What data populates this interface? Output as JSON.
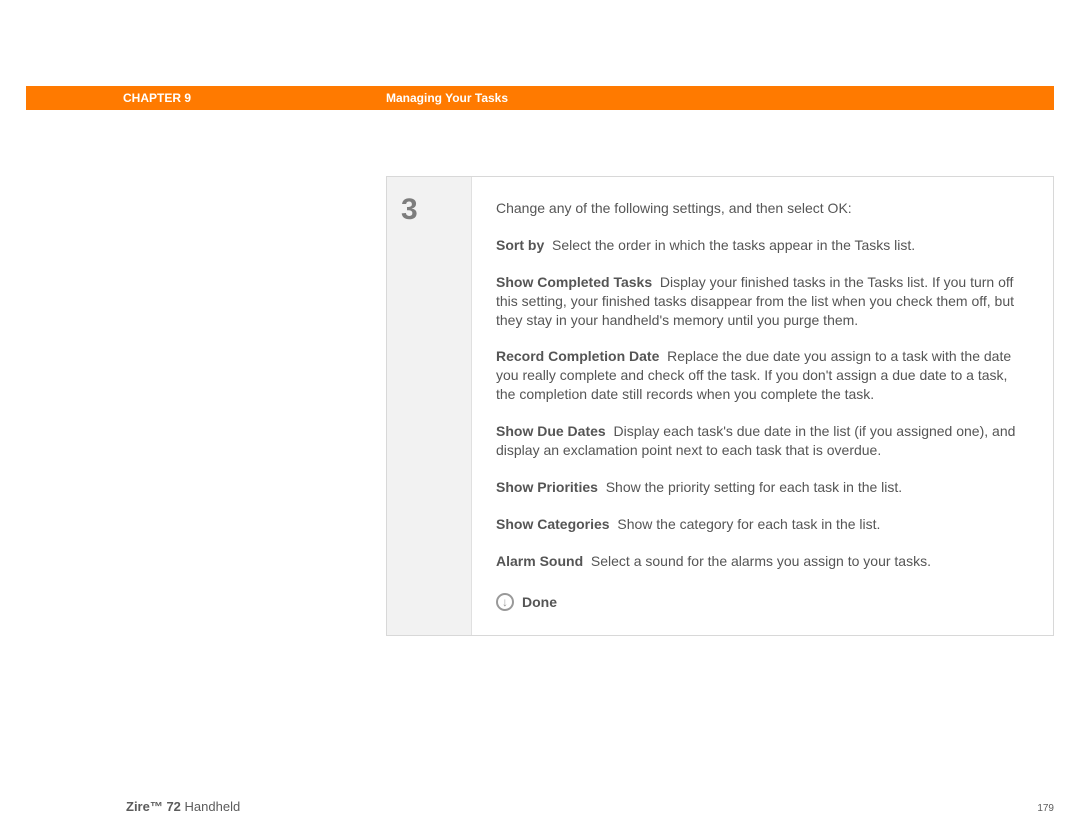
{
  "header": {
    "chapter_label": "CHAPTER 9",
    "page_title": "Managing Your Tasks"
  },
  "step": {
    "number": "3",
    "intro": "Change any of the following settings, and then select OK:",
    "settings": [
      {
        "label": "Sort by",
        "desc": "Select the order in which the tasks appear in the Tasks list."
      },
      {
        "label": "Show Completed Tasks",
        "desc": "Display your finished tasks in the Tasks list. If you turn off this setting, your finished tasks disappear from the list when you check them off, but they stay in your handheld's memory until you purge them."
      },
      {
        "label": "Record Completion Date",
        "desc": "Replace the due date you assign to a task with the date you really complete and check off the task. If you don't assign a due date to a task, the completion date still records when you complete the task."
      },
      {
        "label": "Show Due Dates",
        "desc": "Display each task's due date in the list (if you assigned one), and display an exclamation point next to each task that is overdue."
      },
      {
        "label": "Show Priorities",
        "desc": "Show the priority setting for each task in the list."
      },
      {
        "label": "Show Categories",
        "desc": "Show the category for each task in the list."
      },
      {
        "label": "Alarm Sound",
        "desc": "Select a sound for the alarms you assign to your tasks."
      }
    ],
    "done_label": "Done"
  },
  "footer": {
    "product_bold": "Zire™ 72",
    "product_rest": " Handheld",
    "page_number": "179"
  }
}
